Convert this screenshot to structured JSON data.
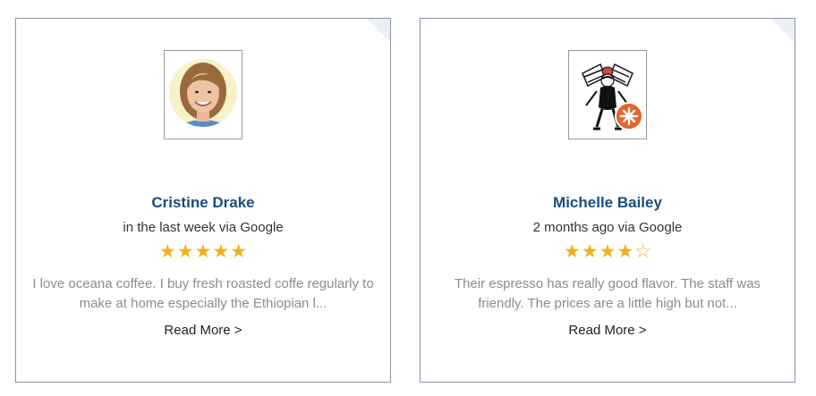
{
  "reviews": [
    {
      "name": "Cristine Drake",
      "meta": "in the last week via Google",
      "rating": 5,
      "max_rating": 5,
      "text": "I love oceana coffee. I buy fresh roasted coffe regularly to make at home especially the Ethiopian l...",
      "read_more": "Read More >"
    },
    {
      "name": "Michelle Bailey",
      "meta": "2 months ago via Google",
      "rating": 4,
      "max_rating": 5,
      "text": "Their espresso has really good flavor. The staff was friendly. The prices are a little high but not...",
      "read_more": "Read More >"
    }
  ],
  "colors": {
    "name": "#184e7e",
    "star": "#f2b01e",
    "review_text": "#8c8c8c",
    "card_border": "#8a93a6"
  }
}
